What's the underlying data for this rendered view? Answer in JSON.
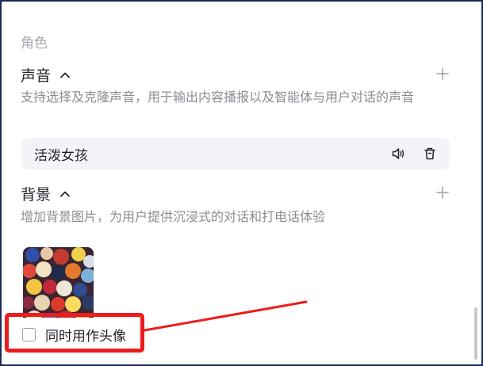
{
  "role": {
    "label": "角色"
  },
  "voice": {
    "title": "声音",
    "description": "支持选择及克隆声音，用于输出内容播报以及智能体与用户对话的声音",
    "selected": "活泼女孩",
    "icons": {
      "collapse": "chevron-up-icon",
      "add": "plus-icon",
      "play": "speaker-icon",
      "delete": "trash-icon"
    }
  },
  "background": {
    "title": "背景",
    "description": "增加背景图片，为用户提供沉浸式的对话和打电话体验",
    "icons": {
      "collapse": "chevron-up-icon",
      "add": "plus-icon"
    },
    "use_as_avatar": {
      "label": "同时用作头像",
      "checked": false
    }
  },
  "colors": {
    "annotation": "#ee1c1c",
    "panel_border": "#1c2b5a",
    "text_primary": "#1f2329",
    "text_secondary": "#8a8d93"
  }
}
